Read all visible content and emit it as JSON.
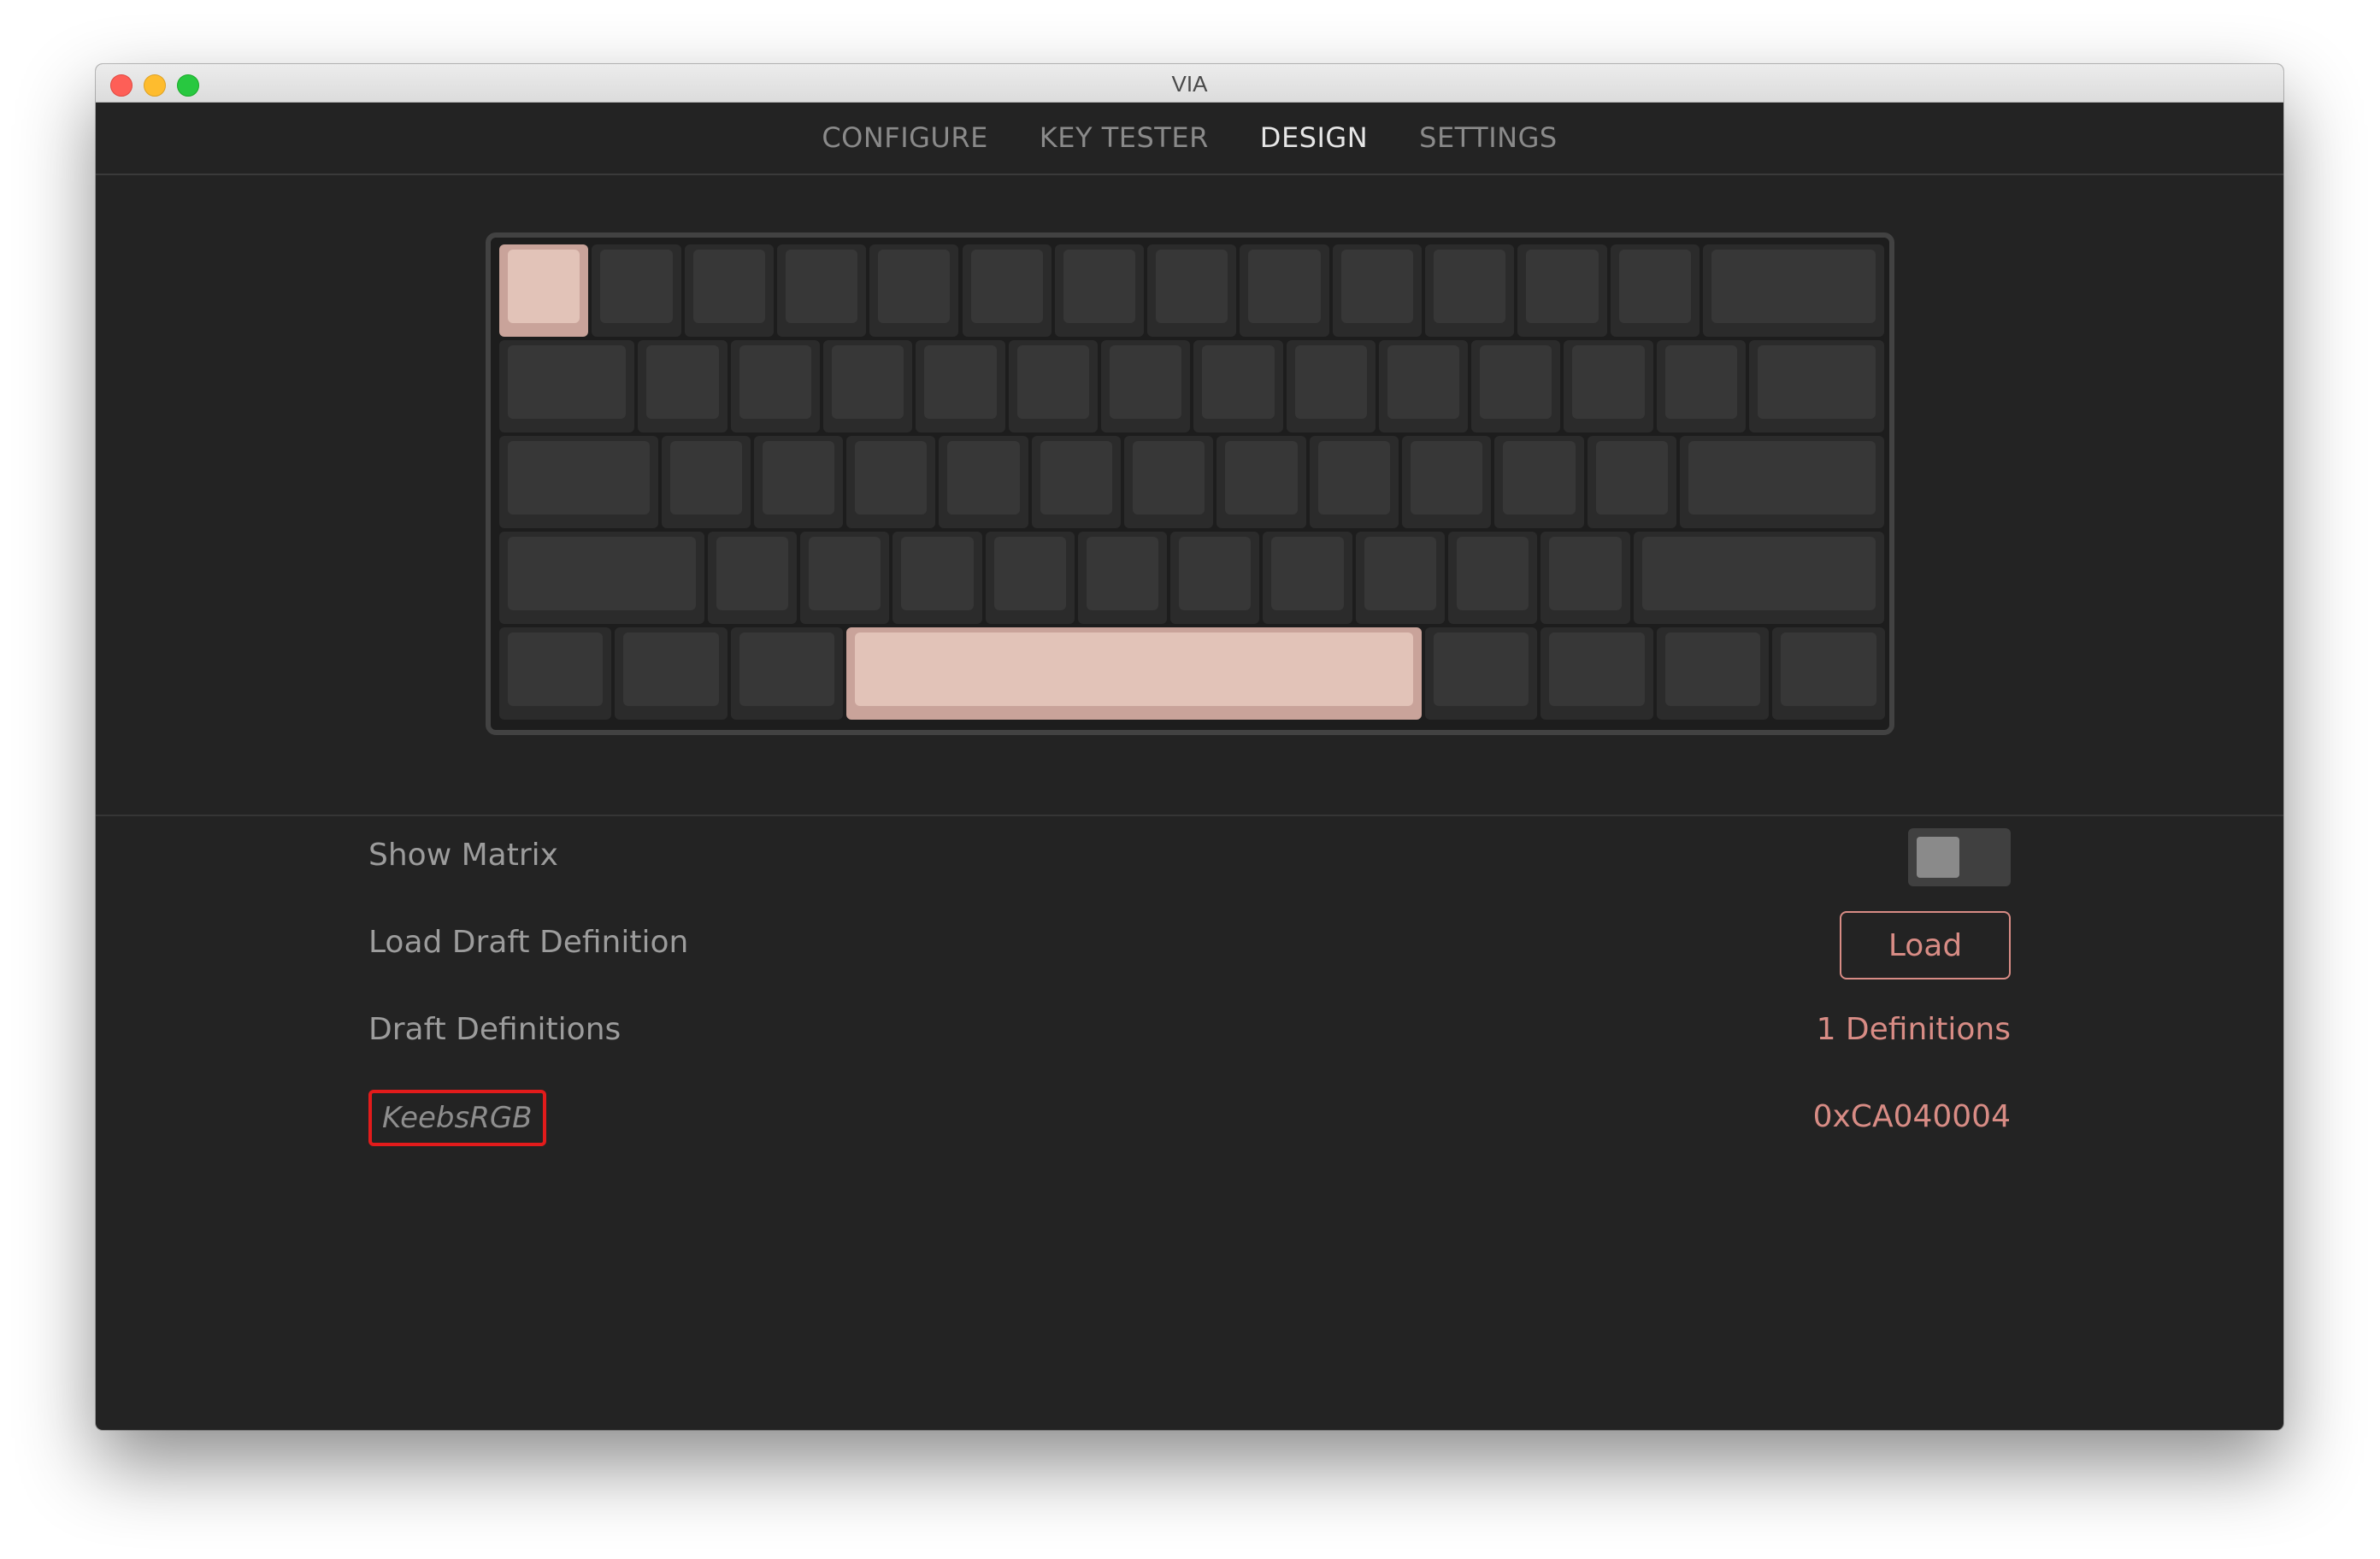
{
  "window": {
    "title": "VIA"
  },
  "nav": {
    "tabs": [
      {
        "label": "CONFIGURE",
        "active": false
      },
      {
        "label": "KEY TESTER",
        "active": false
      },
      {
        "label": "DESIGN",
        "active": true
      },
      {
        "label": "SETTINGS",
        "active": false
      }
    ]
  },
  "keyboard": {
    "selected_keys": [
      "Esc",
      "Space"
    ]
  },
  "settings": {
    "show_matrix": {
      "label": "Show Matrix",
      "enabled": false
    },
    "load_draft": {
      "label": "Load Draft Definition",
      "button_label": "Load"
    },
    "draft_definitions": {
      "label": "Draft Definitions",
      "value": "1 Definitions"
    },
    "definition": {
      "name": "KeebsRGB",
      "vendor_product_id": "0xCA040004"
    }
  },
  "colors": {
    "accent": "#d88c85",
    "selected_key": "#e2c3b8",
    "highlight_box": "#e21b1b"
  }
}
